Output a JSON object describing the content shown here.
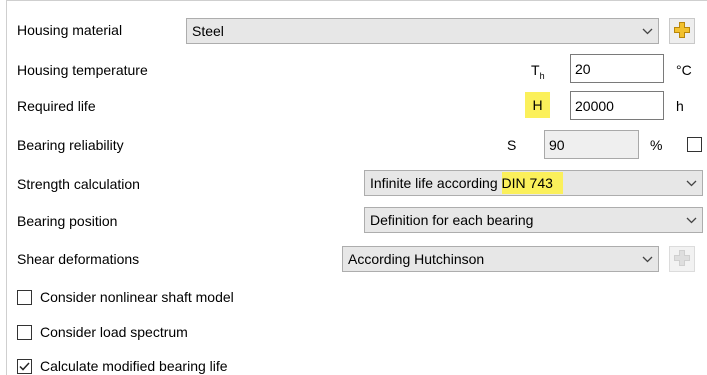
{
  "housing_material": {
    "label": "Housing material",
    "value": "Steel"
  },
  "housing_temperature": {
    "label": "Housing temperature",
    "symbol": "T",
    "symbol_sub": "h",
    "value": "20",
    "unit": "°C"
  },
  "required_life": {
    "label": "Required life",
    "symbol": "H",
    "value": "20000",
    "unit": "h"
  },
  "bearing_reliability": {
    "label": "Bearing reliability",
    "symbol": "S",
    "value": "90",
    "unit": "%",
    "checked": false
  },
  "strength_calculation": {
    "label": "Strength calculation",
    "value_part1": "Infinite life according ",
    "value_part2": "DIN 743"
  },
  "bearing_position": {
    "label": "Bearing position",
    "value": "Definition for each bearing"
  },
  "shear_deformations": {
    "label": "Shear deformations",
    "value": "According Hutchinson"
  },
  "checkboxes": [
    {
      "label": "Consider nonlinear shaft model",
      "checked": false
    },
    {
      "label": "Consider load spectrum",
      "checked": false
    },
    {
      "label": "Calculate modified bearing life",
      "checked": true
    }
  ],
  "colors": {
    "highlight": "#fbf05b",
    "plus_icon": "#f2c12e"
  }
}
